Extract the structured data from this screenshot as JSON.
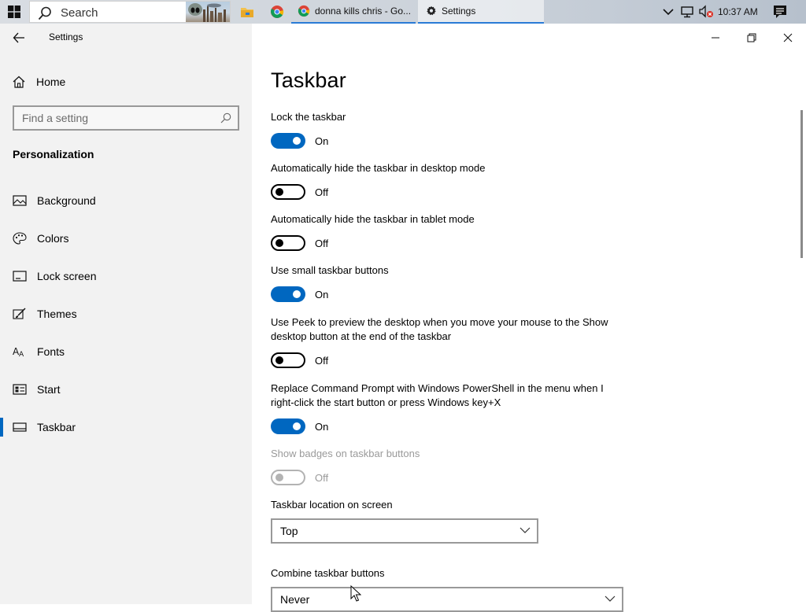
{
  "taskbar": {
    "search_placeholder": "Search",
    "tasks": [
      {
        "label": "donna kills chris - Go...",
        "icon": "chrome-icon"
      },
      {
        "label": "Settings",
        "icon": "gear-icon"
      }
    ],
    "clock": "10:37 AM",
    "tray_icons": [
      "chevron-up-icon",
      "network-icon",
      "volume-muted-icon",
      "notification-icon"
    ]
  },
  "window": {
    "title": "Settings"
  },
  "sidebar": {
    "home_label": "Home",
    "search_placeholder": "Find a setting",
    "section_title": "Personalization",
    "items": [
      {
        "label": "Background",
        "icon": "picture-icon"
      },
      {
        "label": "Colors",
        "icon": "palette-icon"
      },
      {
        "label": "Lock screen",
        "icon": "lock-screen-icon"
      },
      {
        "label": "Themes",
        "icon": "brush-icon"
      },
      {
        "label": "Fonts",
        "icon": "font-icon"
      },
      {
        "label": "Start",
        "icon": "start-icon"
      },
      {
        "label": "Taskbar",
        "icon": "taskbar-icon",
        "selected": true
      }
    ]
  },
  "main": {
    "page_title": "Taskbar",
    "settings": [
      {
        "label": "Lock the taskbar",
        "state": "On",
        "on": true
      },
      {
        "label": "Automatically hide the taskbar in desktop mode",
        "state": "Off",
        "on": false
      },
      {
        "label": "Automatically hide the taskbar in tablet mode",
        "state": "Off",
        "on": false
      },
      {
        "label": "Use small taskbar buttons",
        "state": "On",
        "on": true
      },
      {
        "label": "Use Peek to preview the desktop when you move your mouse to the Show desktop button at the end of the taskbar",
        "state": "Off",
        "on": false
      },
      {
        "label": "Replace Command Prompt with Windows PowerShell in the menu when I right-click the start button or press Windows key+X",
        "state": "On",
        "on": true
      },
      {
        "label": "Show badges on taskbar buttons",
        "state": "Off",
        "on": false,
        "disabled": true
      }
    ],
    "location_label": "Taskbar location on screen",
    "location_value": "Top",
    "combine_label": "Combine taskbar buttons",
    "combine_value": "Never"
  },
  "colors": {
    "accent": "#0067c0",
    "sidebar_bg": "#f2f2f2",
    "disabled_text": "#9a9a9a"
  }
}
